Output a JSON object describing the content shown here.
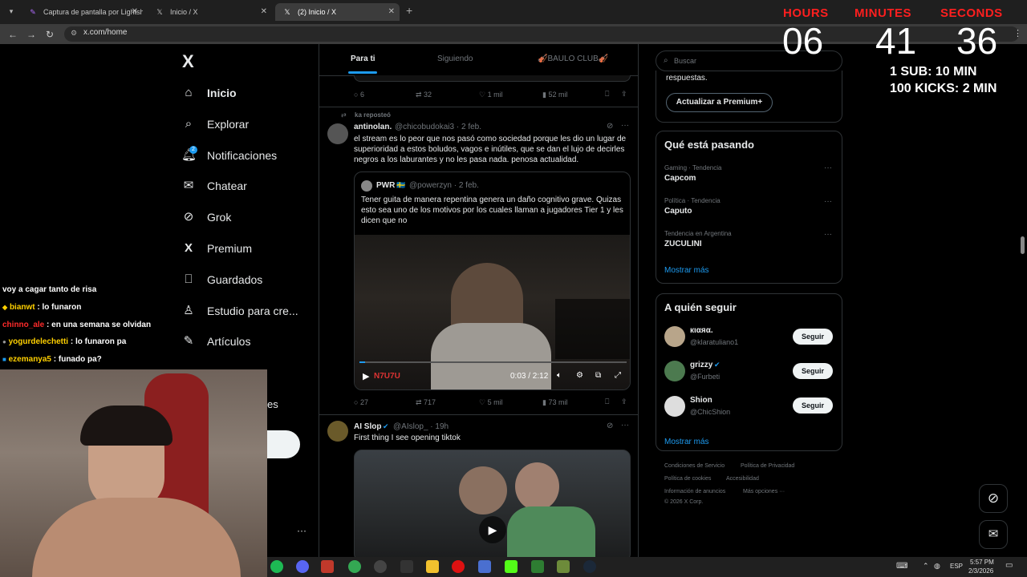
{
  "browser": {
    "tabs": [
      {
        "title": "Captura de pantalla por Lightsh",
        "active": false
      },
      {
        "title": "Inicio / X",
        "active": false
      },
      {
        "title": "(2) Inicio / X",
        "active": true
      }
    ],
    "new_tab": "+",
    "url": "x.com/home"
  },
  "timer": {
    "hours_label": "HOURS",
    "minutes_label": "MINUTES",
    "seconds_label": "SECONDS",
    "hours": "06",
    "minutes": "41",
    "seconds": "36",
    "rule1": "1 SUB: 10 MIN",
    "rule2": "100 KICKS: 2 MIN"
  },
  "nav": {
    "logo": "X",
    "items": [
      {
        "label": "Inicio",
        "icon": "home-icon"
      },
      {
        "label": "Explorar",
        "icon": "search-icon"
      },
      {
        "label": "Notificaciones",
        "icon": "bell-icon",
        "badge": "2"
      },
      {
        "label": "Chatear",
        "icon": "mail-icon"
      },
      {
        "label": "Grok",
        "icon": "grok-icon"
      },
      {
        "label": "Premium",
        "icon": "x-logo-icon"
      },
      {
        "label": "Guardados",
        "icon": "bookmark-icon"
      },
      {
        "label": "Estudio para cre...",
        "icon": "studio-icon"
      },
      {
        "label": "Artículos",
        "icon": "article-icon"
      }
    ],
    "partial_label": "es",
    "more": "···"
  },
  "feed": {
    "tabs": [
      "Para ti",
      "Siguiendo",
      "🎻BAULO CLUB🎻"
    ],
    "top_actions": {
      "replies": "6",
      "reposts": "32",
      "likes": "1 mil",
      "views": "52 mil"
    },
    "post1": {
      "reposted_by": "ka reposteó",
      "name": "antinolan.",
      "handle": "@chicobudokai3 · 2 feb.",
      "text": "el stream es lo peor que nos pasó como sociedad porque les dio un lugar de superioridad a estos boludos, vagos e inútiles, que se dan el lujo de decirles negros a los laburantes y no les pasa nada. penosa actualidad.",
      "quote": {
        "name": "PWR",
        "flag": "🇸🇪",
        "handle": "@powerzyn · 2 feb.",
        "text": "Tener guita de manera repentina genera un daño cognitivo grave. Quizas esto sea uno de los motivos por los cuales llaman a jugadores Tier 1 y les dicen que no",
        "video_time": "0:03 / 2:12",
        "video_brand": "N7U7U"
      },
      "actions": {
        "replies": "27",
        "reposts": "717",
        "likes": "5 mil",
        "views": "73 mil"
      }
    },
    "post2": {
      "name": "AI Slop",
      "handle": "@AIslop_ · 19h",
      "text": "First thing I see opening tiktok"
    }
  },
  "right": {
    "search_placeholder": "Buscar",
    "premium_text": "respuestas.",
    "premium_button": "Actualizar a Premium+",
    "trends_title": "Qué está pasando",
    "trends": [
      {
        "context": "Gaming · Tendencia",
        "name": "Capcom"
      },
      {
        "context": "Política · Tendencia",
        "name": "Caputo"
      },
      {
        "context": "Tendencia en Argentina",
        "name": "ZUCULINI"
      }
    ],
    "show_more": "Mostrar más",
    "follow_title": "A quién seguir",
    "follow": [
      {
        "name": "кιαяα.",
        "handle": "@klaratuliano1",
        "verified": false
      },
      {
        "name": "grizzy",
        "handle": "@Furbeti",
        "verified": true
      },
      {
        "name": "Shion",
        "handle": "@ChicShion",
        "verified": false
      }
    ],
    "follow_button": "Seguir",
    "show_more2": "Mostrar más",
    "footer": {
      "terms": "Condiciones de Servicio",
      "privacy": "Política de Privacidad",
      "cookies": "Política de cookies",
      "access": "Accesibilidad",
      "ads": "Información de anuncios",
      "more": "Más opciones ···",
      "copyright": "© 2026 X Corp."
    }
  },
  "chat": [
    {
      "user": "",
      "text": "voy a cagar tanto de risa",
      "color": "#ffffff"
    },
    {
      "user": "bianwt",
      "text": ": lo funaron",
      "color": "#ffd000"
    },
    {
      "user": "chinno_ale",
      "text": ": en una semana se olvidan",
      "color": "#ff2b2b"
    },
    {
      "user": "yogurdelechetti",
      "text": ": lo funaron pa",
      "color": "#ffd000"
    },
    {
      "user": "ezemanya5",
      "text": ": funado pa?",
      "color": "#ffd000"
    }
  ],
  "taskbar": {
    "lang": "ESP",
    "time": "5:57 PM",
    "date": "2/3/2026"
  }
}
